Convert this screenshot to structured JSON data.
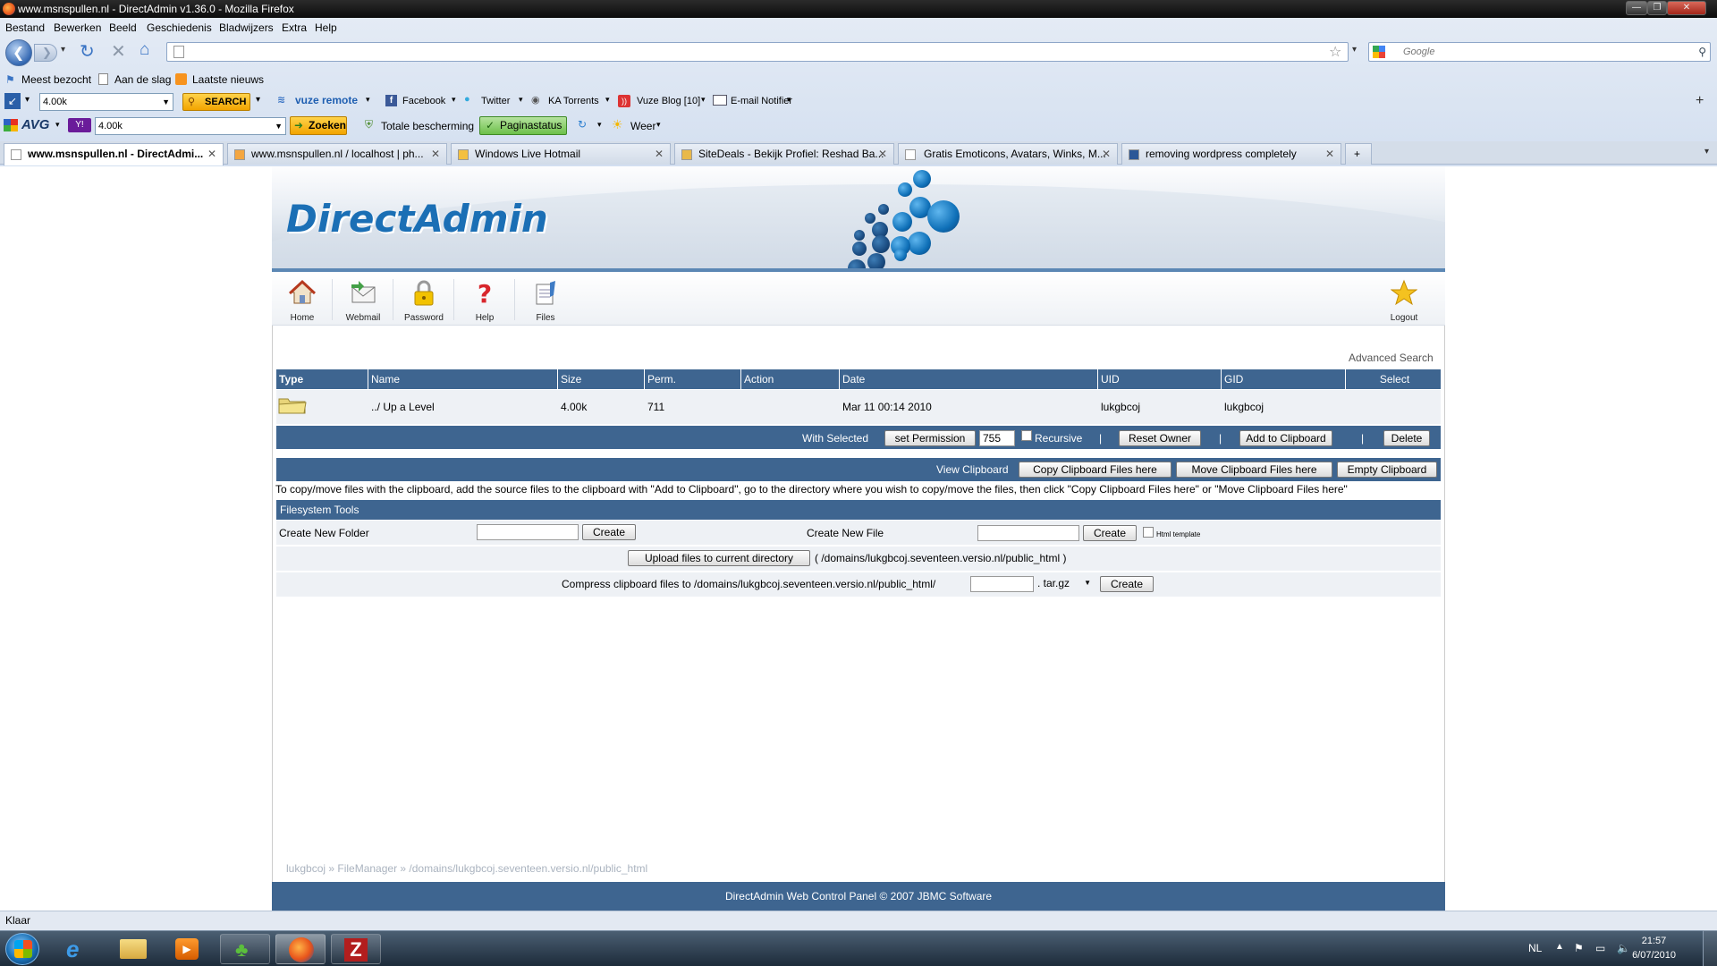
{
  "window": {
    "title": "www.msnspullen.nl - DirectAdmin v1.36.0 - Mozilla Firefox",
    "controls": [
      "—",
      "❐",
      "✕"
    ]
  },
  "menu": [
    "Bestand",
    "Bewerken",
    "Beeld",
    "Geschiedenis",
    "Bladwijzers",
    "Extra",
    "Help"
  ],
  "search": {
    "placeholder": "Google"
  },
  "bookmarks": [
    "Meest bezocht",
    "Aan de slag",
    "Laatste nieuws"
  ],
  "toolbar1": {
    "box_value": "4.00k",
    "search_label": "SEARCH",
    "items": [
      "vuze remote",
      "Facebook",
      "Twitter",
      "KA Torrents",
      "Vuze Blog [10]",
      "E-mail Notifier"
    ]
  },
  "toolbar2": {
    "avg": "AVG",
    "box_value": "4.00k",
    "zoeken": "Zoeken",
    "bescherming": "Totale bescherming",
    "paginastatus": "Paginastatus",
    "weer": "Weer"
  },
  "tabs": [
    "www.msnspullen.nl - DirectAdmi...",
    "www.msnspullen.nl / localhost | ph...",
    "Windows Live Hotmail",
    "SiteDeals - Bekijk Profiel: Reshad Ba...",
    "Gratis Emoticons, Avatars, Winks, M...",
    "removing wordpress completely"
  ],
  "brand": {
    "logo": "DirectAdmin"
  },
  "nav": [
    {
      "label": "Home",
      "icon": "home-icon"
    },
    {
      "label": "Webmail",
      "icon": "webmail-icon"
    },
    {
      "label": "Password",
      "icon": "password-lock-icon"
    },
    {
      "label": "Help",
      "icon": "help-question-icon"
    },
    {
      "label": "Files",
      "icon": "files-icon"
    },
    {
      "label": "Logout",
      "icon": "logout-star-icon"
    }
  ],
  "advanced_search": "Advanced Search",
  "table": {
    "headers": [
      "Type",
      "Name",
      "Size",
      "Perm.",
      "Action",
      "Date",
      "UID",
      "GID",
      "Select"
    ],
    "rows": [
      {
        "type": "folder-icon",
        "name": "../ Up a Level",
        "size": "4.00k",
        "perm": "711",
        "action": "",
        "date": "Mar 11 00:14 2010",
        "uid": "lukgbcoj",
        "gid": "lukgbcoj",
        "select": ""
      }
    ]
  },
  "with_selected": {
    "label": "With Selected",
    "set_permission": "set Permission",
    "perm_value": "755",
    "recursive": "Recursive",
    "reset_owner": "Reset Owner",
    "add_clipboard": "Add to Clipboard",
    "delete": "Delete",
    "sep": "|"
  },
  "clipboard": {
    "label": "View Clipboard",
    "copy": "Copy Clipboard Files here",
    "move": "Move Clipboard Files here",
    "empty": "Empty Clipboard",
    "help": "To copy/move files with the clipboard, add the source files to the clipboard with \"Add to Clipboard\", go to the directory where you wish to copy/move the files, then click \"Copy Clipboard Files here\" or \"Move Clipboard Files here\""
  },
  "fstools": {
    "title": "Filesystem Tools",
    "new_folder": "Create New Folder",
    "new_file": "Create New File",
    "create": "Create",
    "html_template": "Html template",
    "upload": "Upload files to current directory",
    "upload_path": "( /domains/lukgbcoj.seventeen.versio.nl/public_html )",
    "compress_label": "Compress clipboard files to /domains/lukgbcoj.seventeen.versio.nl/public_html/",
    "compress_ext": ". tar.gz"
  },
  "breadcrumb": "lukgbcoj » FileManager » /domains/lukgbcoj.seventeen.versio.nl/public_html",
  "footer": "DirectAdmin Web Control Panel © 2007 JBMC Software",
  "status": "Klaar",
  "tray": {
    "lang": "NL",
    "time": "21:57",
    "date": "6/07/2010"
  }
}
